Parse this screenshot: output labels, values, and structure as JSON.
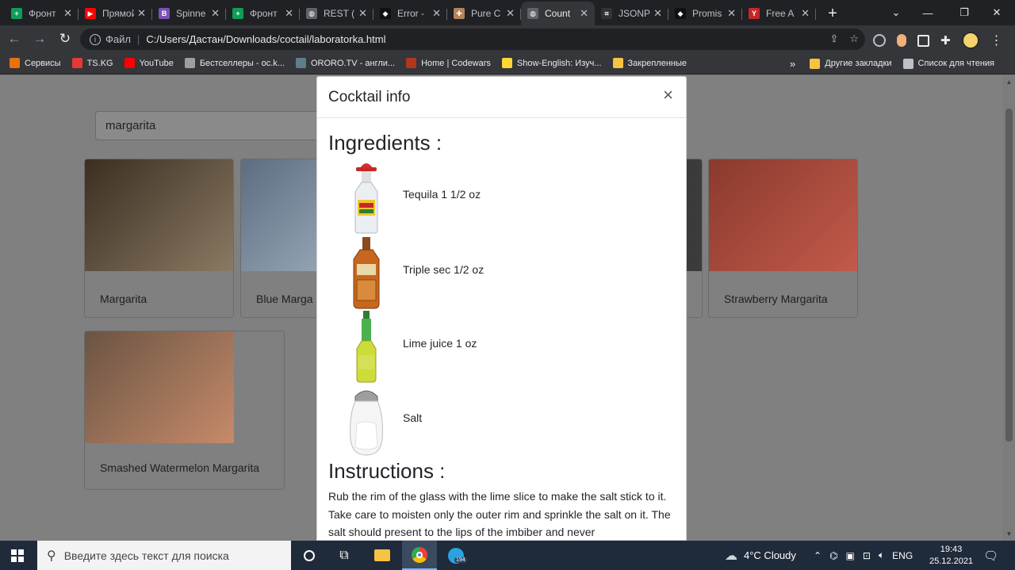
{
  "browser": {
    "tabs": [
      {
        "title": "Фронт",
        "icon": "sheets-icon",
        "color": "#0f9d58",
        "glyph": "+"
      },
      {
        "title": "Прямой",
        "icon": "youtube-icon",
        "color": "#ff0000",
        "glyph": "▶"
      },
      {
        "title": "Spinne",
        "icon": "bootstrap-icon",
        "color": "#7952b3",
        "glyph": "B"
      },
      {
        "title": "Фронт",
        "icon": "sheets-icon",
        "color": "#0f9d58",
        "glyph": "+"
      },
      {
        "title": "REST (",
        "icon": "globe-icon",
        "color": "#5f6368",
        "glyph": "◍"
      },
      {
        "title": "Error -",
        "icon": "octo-icon",
        "color": "#111111",
        "glyph": "◆"
      },
      {
        "title": "Pure C",
        "icon": "puzzle-icon",
        "color": "#b5835a",
        "glyph": "✚"
      },
      {
        "title": "Count",
        "icon": "globe-icon",
        "color": "#5f6368",
        "glyph": "◍",
        "active": true
      },
      {
        "title": "JSONP",
        "icon": "code-icon",
        "color": "#333333",
        "glyph": "⌗"
      },
      {
        "title": "Promis",
        "icon": "octo-icon",
        "color": "#111111",
        "glyph": "◆"
      },
      {
        "title": "Free A",
        "icon": "cocktail-icon",
        "color": "#c62828",
        "glyph": "Y"
      }
    ],
    "address": {
      "scheme": "Файл",
      "url": "C:/Users/Дастан/Downloads/coctail/laboratorka.html"
    },
    "bookmarks": [
      {
        "label": "Сервисы",
        "icon": "apps-icon",
        "color": "#e8710a"
      },
      {
        "label": "TS.KG",
        "icon": "tskg-icon",
        "color": "#e53935"
      },
      {
        "label": "YouTube",
        "icon": "youtube-icon",
        "color": "#ff0000"
      },
      {
        "label": "Бестселлеры - ос.k...",
        "icon": "book-icon",
        "color": "#9e9e9e"
      },
      {
        "label": "ORORO.TV - англи...",
        "icon": "ororo-icon",
        "color": "#607d8b"
      },
      {
        "label": "Home | Codewars",
        "icon": "codewars-icon",
        "color": "#b1361e"
      },
      {
        "label": "Show-English: Изуч...",
        "icon": "show-icon",
        "color": "#fdd835"
      },
      {
        "label": "Закрепленные",
        "icon": "folder-icon",
        "color": "#f6c342"
      }
    ],
    "bookmarks_right": [
      {
        "label": "Другие закладки",
        "icon": "folder-icon",
        "color": "#f6c342"
      },
      {
        "label": "Список для чтения",
        "icon": "reading-list-icon",
        "color": "#bdc1c6"
      }
    ],
    "more": "»"
  },
  "page": {
    "search_value": "margarita",
    "cards": [
      {
        "name": "Margarita",
        "colors": [
          "#3b2e22",
          "#8a7a63"
        ]
      },
      {
        "name": "Blue Marga",
        "colors": [
          "#5d6d80",
          "#a8b8c8"
        ]
      },
      {
        "name": "Strawberry Margarita",
        "colors": [
          "#8a3a2e",
          "#c25a4a"
        ]
      },
      {
        "name": "Smashed Watermelon Margarita",
        "colors": [
          "#6a5443",
          "#c78a6a"
        ]
      }
    ]
  },
  "modal": {
    "title": "Cocktail info",
    "close": "×",
    "ingredients_heading": "Ingredients :",
    "ingredients": [
      {
        "label": "Tequila 1 1/2 oz",
        "icon": "tequila-bottle-icon"
      },
      {
        "label": "Triple sec 1/2 oz",
        "icon": "triple-sec-bottle-icon"
      },
      {
        "label": "Lime juice 1 oz",
        "icon": "lime-juice-bottle-icon"
      },
      {
        "label": "Salt",
        "icon": "salt-shaker-icon"
      }
    ],
    "instructions_heading": "Instructions :",
    "instructions": "Rub the rim of the glass with the lime slice to make the salt stick to it. Take care to moisten only the outer rim and sprinkle the salt on it. The salt should present to the lips of the imbiber and never"
  },
  "taskbar": {
    "search_placeholder": "Введите здесь текст для поиска",
    "weather": "4°C  Cloudy",
    "language": "ENG",
    "time": "19:43",
    "date": "25.12.2021",
    "telegram_badge": "194"
  }
}
